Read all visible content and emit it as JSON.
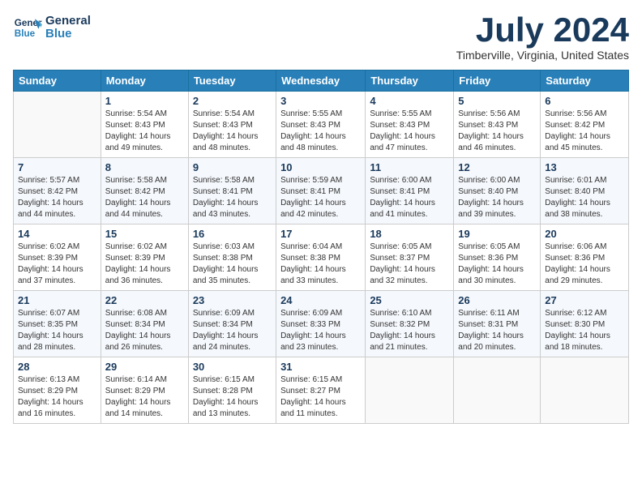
{
  "header": {
    "logo_line1": "General",
    "logo_line2": "Blue",
    "month": "July 2024",
    "location": "Timberville, Virginia, United States"
  },
  "days_of_week": [
    "Sunday",
    "Monday",
    "Tuesday",
    "Wednesday",
    "Thursday",
    "Friday",
    "Saturday"
  ],
  "weeks": [
    [
      {
        "day": "",
        "info": ""
      },
      {
        "day": "1",
        "info": "Sunrise: 5:54 AM\nSunset: 8:43 PM\nDaylight: 14 hours\nand 49 minutes."
      },
      {
        "day": "2",
        "info": "Sunrise: 5:54 AM\nSunset: 8:43 PM\nDaylight: 14 hours\nand 48 minutes."
      },
      {
        "day": "3",
        "info": "Sunrise: 5:55 AM\nSunset: 8:43 PM\nDaylight: 14 hours\nand 48 minutes."
      },
      {
        "day": "4",
        "info": "Sunrise: 5:55 AM\nSunset: 8:43 PM\nDaylight: 14 hours\nand 47 minutes."
      },
      {
        "day": "5",
        "info": "Sunrise: 5:56 AM\nSunset: 8:43 PM\nDaylight: 14 hours\nand 46 minutes."
      },
      {
        "day": "6",
        "info": "Sunrise: 5:56 AM\nSunset: 8:42 PM\nDaylight: 14 hours\nand 45 minutes."
      }
    ],
    [
      {
        "day": "7",
        "info": "Sunrise: 5:57 AM\nSunset: 8:42 PM\nDaylight: 14 hours\nand 44 minutes."
      },
      {
        "day": "8",
        "info": "Sunrise: 5:58 AM\nSunset: 8:42 PM\nDaylight: 14 hours\nand 44 minutes."
      },
      {
        "day": "9",
        "info": "Sunrise: 5:58 AM\nSunset: 8:41 PM\nDaylight: 14 hours\nand 43 minutes."
      },
      {
        "day": "10",
        "info": "Sunrise: 5:59 AM\nSunset: 8:41 PM\nDaylight: 14 hours\nand 42 minutes."
      },
      {
        "day": "11",
        "info": "Sunrise: 6:00 AM\nSunset: 8:41 PM\nDaylight: 14 hours\nand 41 minutes."
      },
      {
        "day": "12",
        "info": "Sunrise: 6:00 AM\nSunset: 8:40 PM\nDaylight: 14 hours\nand 39 minutes."
      },
      {
        "day": "13",
        "info": "Sunrise: 6:01 AM\nSunset: 8:40 PM\nDaylight: 14 hours\nand 38 minutes."
      }
    ],
    [
      {
        "day": "14",
        "info": "Sunrise: 6:02 AM\nSunset: 8:39 PM\nDaylight: 14 hours\nand 37 minutes."
      },
      {
        "day": "15",
        "info": "Sunrise: 6:02 AM\nSunset: 8:39 PM\nDaylight: 14 hours\nand 36 minutes."
      },
      {
        "day": "16",
        "info": "Sunrise: 6:03 AM\nSunset: 8:38 PM\nDaylight: 14 hours\nand 35 minutes."
      },
      {
        "day": "17",
        "info": "Sunrise: 6:04 AM\nSunset: 8:38 PM\nDaylight: 14 hours\nand 33 minutes."
      },
      {
        "day": "18",
        "info": "Sunrise: 6:05 AM\nSunset: 8:37 PM\nDaylight: 14 hours\nand 32 minutes."
      },
      {
        "day": "19",
        "info": "Sunrise: 6:05 AM\nSunset: 8:36 PM\nDaylight: 14 hours\nand 30 minutes."
      },
      {
        "day": "20",
        "info": "Sunrise: 6:06 AM\nSunset: 8:36 PM\nDaylight: 14 hours\nand 29 minutes."
      }
    ],
    [
      {
        "day": "21",
        "info": "Sunrise: 6:07 AM\nSunset: 8:35 PM\nDaylight: 14 hours\nand 28 minutes."
      },
      {
        "day": "22",
        "info": "Sunrise: 6:08 AM\nSunset: 8:34 PM\nDaylight: 14 hours\nand 26 minutes."
      },
      {
        "day": "23",
        "info": "Sunrise: 6:09 AM\nSunset: 8:34 PM\nDaylight: 14 hours\nand 24 minutes."
      },
      {
        "day": "24",
        "info": "Sunrise: 6:09 AM\nSunset: 8:33 PM\nDaylight: 14 hours\nand 23 minutes."
      },
      {
        "day": "25",
        "info": "Sunrise: 6:10 AM\nSunset: 8:32 PM\nDaylight: 14 hours\nand 21 minutes."
      },
      {
        "day": "26",
        "info": "Sunrise: 6:11 AM\nSunset: 8:31 PM\nDaylight: 14 hours\nand 20 minutes."
      },
      {
        "day": "27",
        "info": "Sunrise: 6:12 AM\nSunset: 8:30 PM\nDaylight: 14 hours\nand 18 minutes."
      }
    ],
    [
      {
        "day": "28",
        "info": "Sunrise: 6:13 AM\nSunset: 8:29 PM\nDaylight: 14 hours\nand 16 minutes."
      },
      {
        "day": "29",
        "info": "Sunrise: 6:14 AM\nSunset: 8:29 PM\nDaylight: 14 hours\nand 14 minutes."
      },
      {
        "day": "30",
        "info": "Sunrise: 6:15 AM\nSunset: 8:28 PM\nDaylight: 14 hours\nand 13 minutes."
      },
      {
        "day": "31",
        "info": "Sunrise: 6:15 AM\nSunset: 8:27 PM\nDaylight: 14 hours\nand 11 minutes."
      },
      {
        "day": "",
        "info": ""
      },
      {
        "day": "",
        "info": ""
      },
      {
        "day": "",
        "info": ""
      }
    ]
  ]
}
